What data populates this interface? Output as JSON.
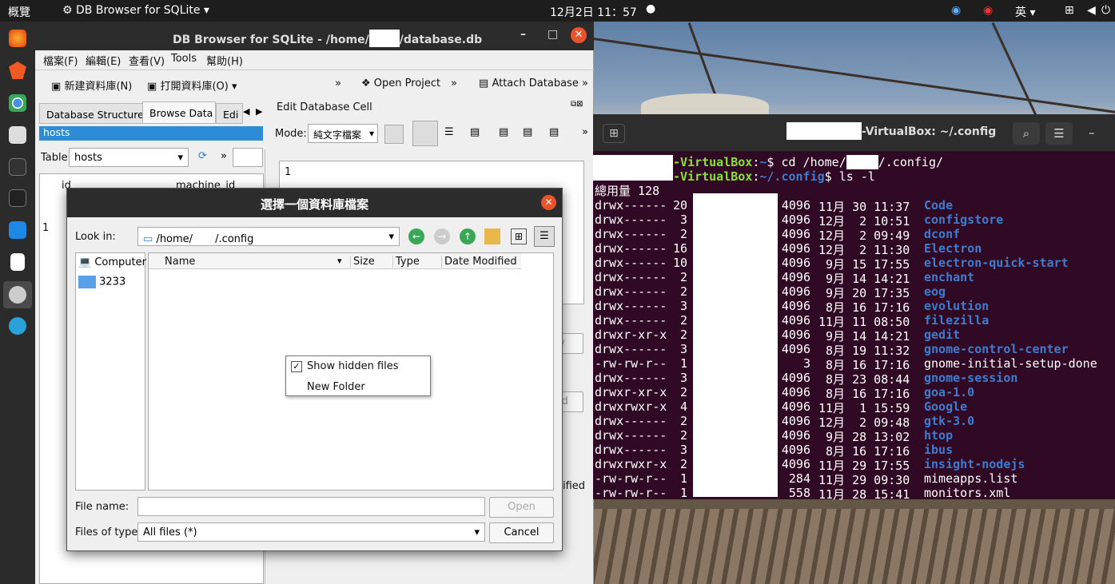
{
  "topbar": {
    "activities": "概覽",
    "app": "DB Browser for SQLite",
    "clock": "12月2日  11：57",
    "ime": "英"
  },
  "db": {
    "title": "DB Browser for SQLite - /home/",
    "title_end": "/database.db",
    "menus": [
      "檔案(F)",
      "編輯(E)",
      "查看(V)",
      "Tools",
      "幫助(H)"
    ],
    "toolbar": {
      "new_db": "新建資料庫(N)",
      "open_db": "打開資料庫(O)",
      "open_project": "Open Project",
      "attach": "Attach Database",
      "more": "»"
    },
    "tabs": [
      "Database Structure",
      "Browse Data",
      "Edi"
    ],
    "hosts": "hosts",
    "table_label": "Table:",
    "table_value": "hosts",
    "col_id": "id",
    "col_machine": "machine_id",
    "row1": "1",
    "edit_cell": "Edit Database Cell",
    "mode_label": "Mode:",
    "mode_value": "純文字檔案",
    "line1": "1",
    "apply_partial": "ply",
    "upload_partial": "load",
    "modified_partial": "ified"
  },
  "term": {
    "title": "-VirtualBox: ~/.config",
    "prompt1_host": "-VirtualBox",
    "prompt1_path": "~",
    "prompt1_cmd": "$ cd /home/",
    "prompt1_end": "/.config/",
    "prompt2_host": "-VirtualBox",
    "prompt2_path": "~/.config",
    "prompt2_cmd": "$ ls -l",
    "total": "總用量 128",
    "rows": [
      {
        "perm": "drwx------",
        "links": "20",
        "size": "4096",
        "date": "11月 30 11:37",
        "name": "Code",
        "dir": true
      },
      {
        "perm": "drwx------",
        "links": "3",
        "size": "4096",
        "date": "12月  2 10:51",
        "name": "configstore",
        "dir": true
      },
      {
        "perm": "drwx------",
        "links": "2",
        "size": "4096",
        "date": "12月  2 09:49",
        "name": "dconf",
        "dir": true
      },
      {
        "perm": "drwx------",
        "links": "16",
        "size": "4096",
        "date": "12月  2 11:30",
        "name": "Electron",
        "dir": true
      },
      {
        "perm": "drwx------",
        "links": "10",
        "size": "4096",
        "date": " 9月 15 17:55",
        "name": "electron-quick-start",
        "dir": true
      },
      {
        "perm": "drwx------",
        "links": "2",
        "size": "4096",
        "date": " 9月 14 14:21",
        "name": "enchant",
        "dir": true
      },
      {
        "perm": "drwx------",
        "links": "2",
        "size": "4096",
        "date": " 9月 20 17:35",
        "name": "eog",
        "dir": true
      },
      {
        "perm": "drwx------",
        "links": "3",
        "size": "4096",
        "date": " 8月 16 17:16",
        "name": "evolution",
        "dir": true
      },
      {
        "perm": "drwx------",
        "links": "2",
        "size": "4096",
        "date": "11月 11 08:50",
        "name": "filezilla",
        "dir": true
      },
      {
        "perm": "drwxr-xr-x",
        "links": "2",
        "size": "4096",
        "date": " 9月 14 14:21",
        "name": "gedit",
        "dir": true
      },
      {
        "perm": "drwx------",
        "links": "3",
        "size": "4096",
        "date": " 8月 19 11:32",
        "name": "gnome-control-center",
        "dir": true
      },
      {
        "perm": "-rw-rw-r--",
        "links": "1",
        "size": "3",
        "date": " 8月 16 17:16",
        "name": "gnome-initial-setup-done",
        "dir": false
      },
      {
        "perm": "drwx------",
        "links": "3",
        "size": "4096",
        "date": " 8月 23 08:44",
        "name": "gnome-session",
        "dir": true
      },
      {
        "perm": "drwxr-xr-x",
        "links": "2",
        "size": "4096",
        "date": " 8月 16 17:16",
        "name": "goa-1.0",
        "dir": true
      },
      {
        "perm": "drwxrwxr-x",
        "links": "4",
        "size": "4096",
        "date": "11月  1 15:59",
        "name": "Google",
        "dir": true
      },
      {
        "perm": "drwx------",
        "links": "2",
        "size": "4096",
        "date": "12月  2 09:48",
        "name": "gtk-3.0",
        "dir": true
      },
      {
        "perm": "drwx------",
        "links": "2",
        "size": "4096",
        "date": " 9月 28 13:02",
        "name": "htop",
        "dir": true
      },
      {
        "perm": "drwx------",
        "links": "3",
        "size": "4096",
        "date": " 8月 16 17:16",
        "name": "ibus",
        "dir": true
      },
      {
        "perm": "drwxrwxr-x",
        "links": "2",
        "size": "4096",
        "date": "11月 29 17:55",
        "name": "insight-nodejs",
        "dir": true
      },
      {
        "perm": "-rw-rw-r--",
        "links": "1",
        "size": "284",
        "date": "11月 29 09:30",
        "name": "mimeapps.list",
        "dir": false
      },
      {
        "perm": "-rw-rw-r--",
        "links": "1",
        "size": "558",
        "date": "11月 28 15:41",
        "name": "monitors.xml",
        "dir": false
      }
    ]
  },
  "dialog": {
    "title": "選擇一個資料庫檔案",
    "look_in": "Look in:",
    "path": "/home/",
    "path_end": "/.config",
    "sidebar": [
      "Computer",
      "3233"
    ],
    "cols": [
      "Name",
      "Size",
      "Type",
      "Date Modified"
    ],
    "ctx": {
      "show_hidden": "Show hidden files",
      "new_folder": "New Folder"
    },
    "file_name_label": "File name:",
    "file_name_value": "",
    "types_label": "Files of type:",
    "types_value": "All files (*)",
    "open": "Open",
    "cancel": "Cancel"
  },
  "colors": {
    "dir": "#3e7ccf",
    "term_bg": "#300a24",
    "host": "#8ae234"
  }
}
